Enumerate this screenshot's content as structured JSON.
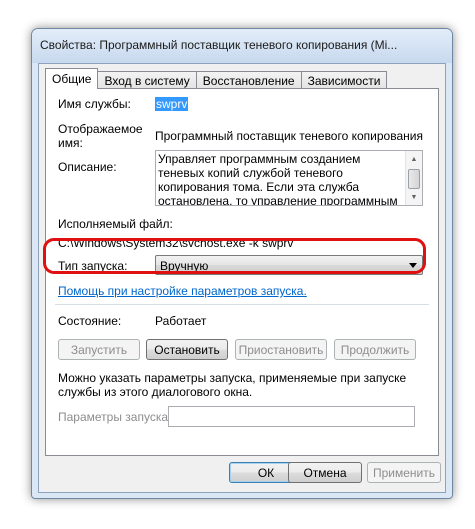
{
  "window": {
    "title": "Свойства: Программный поставщик теневого копирования (Mi..."
  },
  "tabs": [
    {
      "label": "Общие"
    },
    {
      "label": "Вход в систему"
    },
    {
      "label": "Восстановление"
    },
    {
      "label": "Зависимости"
    }
  ],
  "general": {
    "service_name_label": "Имя службы:",
    "service_name_value": "swprv",
    "display_name_label_line1": "Отображаемое",
    "display_name_label_line2": "имя:",
    "display_name_value": "Программный поставщик теневого копирования (Mi",
    "description_label": "Описание:",
    "description_value": "Управляет программным созданием теневых копий службой теневого копирования тома. Если эта служба остановлена, то управление программным созданием теневых копий",
    "exe_label": "Исполняемый файл:",
    "exe_value": "C:\\Windows\\System32\\svchost.exe -k swprv",
    "startup_type_label": "Тип запуска:",
    "startup_type_value": "Вручную",
    "help_link": "Помощь при настройке параметров запуска.",
    "status_label": "Состояние:",
    "status_value": "Работает",
    "start_button": "Запустить",
    "stop_button": "Остановить",
    "pause_button": "Приостановить",
    "resume_button": "Продолжить",
    "params_hint": "Можно указать параметры запуска, применяемые при запуске службы из этого диалогового окна.",
    "params_label": "Параметры запуска:",
    "params_value": ""
  },
  "footer": {
    "ok_button": "ОК",
    "cancel_button": "Отмена",
    "apply_button": "Применить"
  },
  "colors": {
    "highlight_ring": "#e01010",
    "link": "#0066cc",
    "selection": "#3399ff"
  }
}
